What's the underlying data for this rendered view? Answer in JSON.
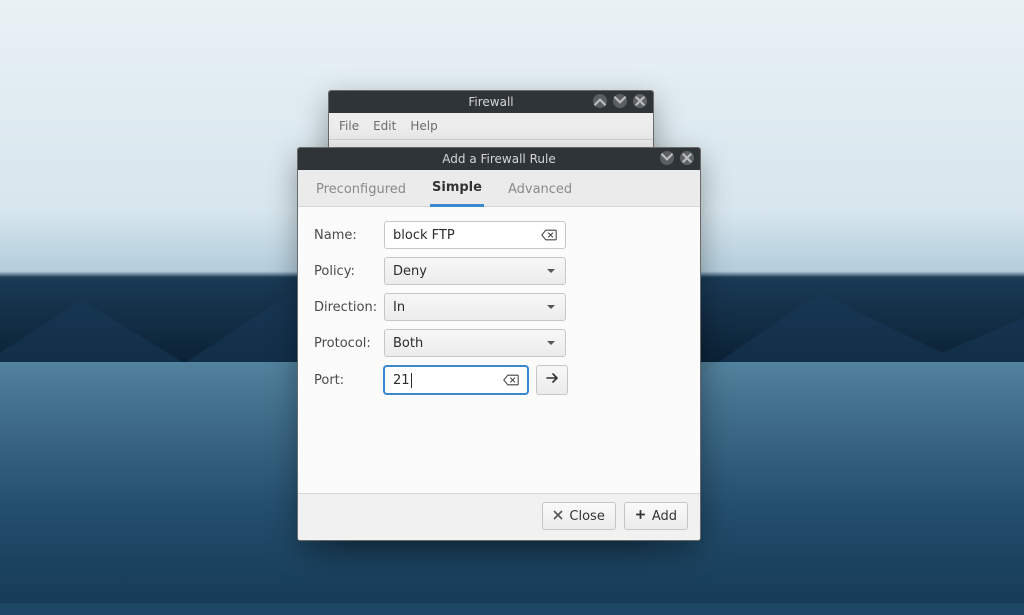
{
  "parent_window": {
    "title": "Firewall",
    "menu": {
      "file": "File",
      "edit": "Edit",
      "help": "Help"
    }
  },
  "dialog": {
    "title": "Add a Firewall Rule",
    "tabs": {
      "preconfigured": "Preconfigured",
      "simple": "Simple",
      "advanced": "Advanced",
      "active": "simple"
    },
    "form": {
      "name": {
        "label": "Name:",
        "value": "block FTP"
      },
      "policy": {
        "label": "Policy:",
        "value": "Deny"
      },
      "direction": {
        "label": "Direction:",
        "value": "In"
      },
      "protocol": {
        "label": "Protocol:",
        "value": "Both"
      },
      "port": {
        "label": "Port:",
        "value": "21"
      }
    },
    "buttons": {
      "close": "Close",
      "add": "Add"
    }
  },
  "icons": {
    "clear": "backspace-icon",
    "arrow": "arrow-right-icon",
    "minimize": "minimize-icon",
    "maximize": "maximize-icon",
    "close_x": "close-icon",
    "plus": "plus-icon",
    "x": "x-icon"
  }
}
